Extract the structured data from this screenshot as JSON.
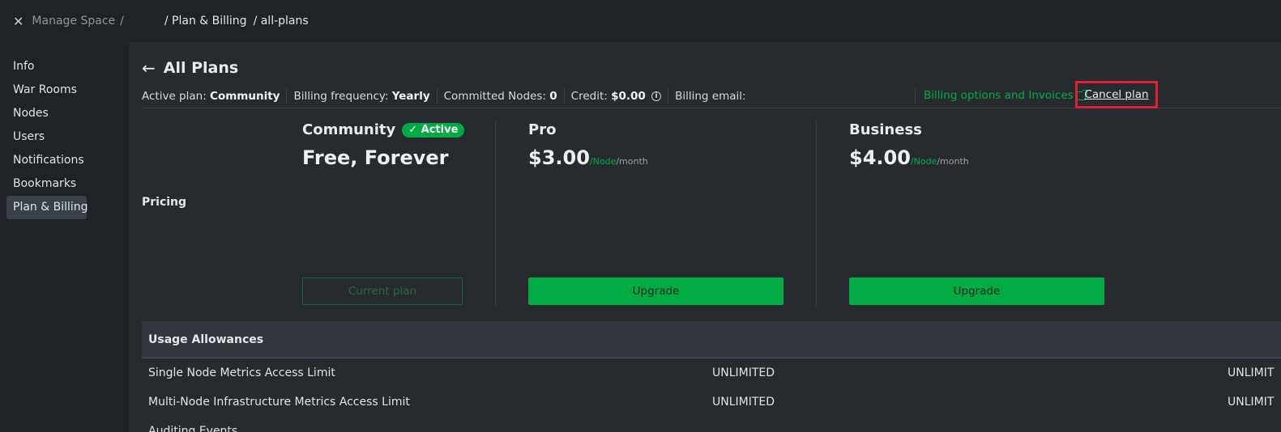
{
  "topbar": {
    "manage_space": "Manage Space",
    "slash": "/",
    "crumb_billing": "/ Plan & Billing",
    "crumb_plans": "/ all-plans"
  },
  "sidebar": {
    "items": [
      {
        "label": "Info"
      },
      {
        "label": "War Rooms"
      },
      {
        "label": "Nodes"
      },
      {
        "label": "Users"
      },
      {
        "label": "Notifications"
      },
      {
        "label": "Bookmarks"
      },
      {
        "label": "Plan & Billing",
        "active": true
      }
    ]
  },
  "page": {
    "title": "All Plans"
  },
  "infobar": {
    "active_plan_label": "Active plan:",
    "active_plan_value": "Community",
    "billing_freq_label": "Billing frequency:",
    "billing_freq_value": "Yearly",
    "committed_label": "Committed Nodes:",
    "committed_value": "0",
    "credit_label": "Credit:",
    "credit_value": "$0.00",
    "email_label": "Billing email:",
    "billing_link": "Billing options and Invoices",
    "cancel_plan": "Cancel plan"
  },
  "pricing": {
    "label": "Pricing",
    "plans": [
      {
        "name": "Community",
        "badge": "✓ Active",
        "price": "Free, Forever",
        "button": "Current plan"
      },
      {
        "name": "Pro",
        "price": "$3.00",
        "unit_node": "/Node",
        "unit_month": "/month",
        "button": "Upgrade"
      },
      {
        "name": "Business",
        "price": "$4.00",
        "unit_node": "/Node",
        "unit_month": "/month",
        "button": "Upgrade"
      }
    ]
  },
  "usage": {
    "title": "Usage Allowances",
    "rows": [
      {
        "label": "Single Node Metrics Access Limit",
        "v1": "UNLIMITED",
        "v2": "UNLIMIT"
      },
      {
        "label": "Multi-Node Infrastructure Metrics Access Limit",
        "v1": "UNLIMITED",
        "v2": "UNLIMIT"
      },
      {
        "label": "Auditing Events",
        "v1": "",
        "v2": ""
      }
    ]
  },
  "colors": {
    "accent": "#00ab44",
    "highlight": "#e0202f",
    "background": "#272b30",
    "sidebar": "#1f2226"
  }
}
